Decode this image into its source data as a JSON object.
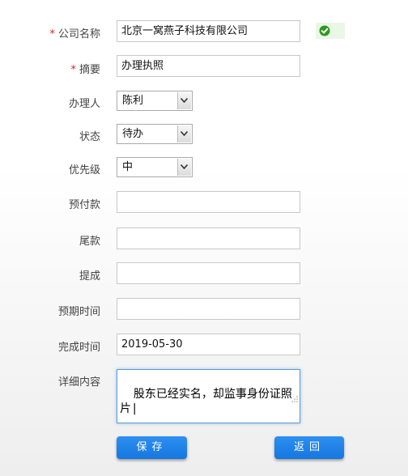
{
  "form": {
    "company": {
      "label": "公司名称",
      "required": true,
      "value": "北京一窝燕子科技有限公司",
      "status_icon": "check-circle-icon",
      "status_color": "#2c9a1f"
    },
    "summary": {
      "label": "摘要",
      "required": true,
      "value": "办理执照"
    },
    "handler": {
      "label": "办理人",
      "selected": "陈利"
    },
    "status": {
      "label": "状态",
      "selected": "待办"
    },
    "priority": {
      "label": "优先级",
      "selected": "中"
    },
    "prepayment": {
      "label": "预付款",
      "value": ""
    },
    "balance": {
      "label": "尾款",
      "value": ""
    },
    "commission": {
      "label": "提成",
      "value": ""
    },
    "expected_time": {
      "label": "预期时间",
      "value": ""
    },
    "completion_time": {
      "label": "完成时间",
      "value": "2019-05-30"
    },
    "details": {
      "label": "详细内容",
      "value": "股东已经实名，却监事身份证照片|"
    }
  },
  "buttons": {
    "save": "保存",
    "back": "返回"
  },
  "colors": {
    "required": "#e02020",
    "button": "#1a7fe8",
    "focus_border": "#5b9bd5"
  },
  "required_mark": "*"
}
